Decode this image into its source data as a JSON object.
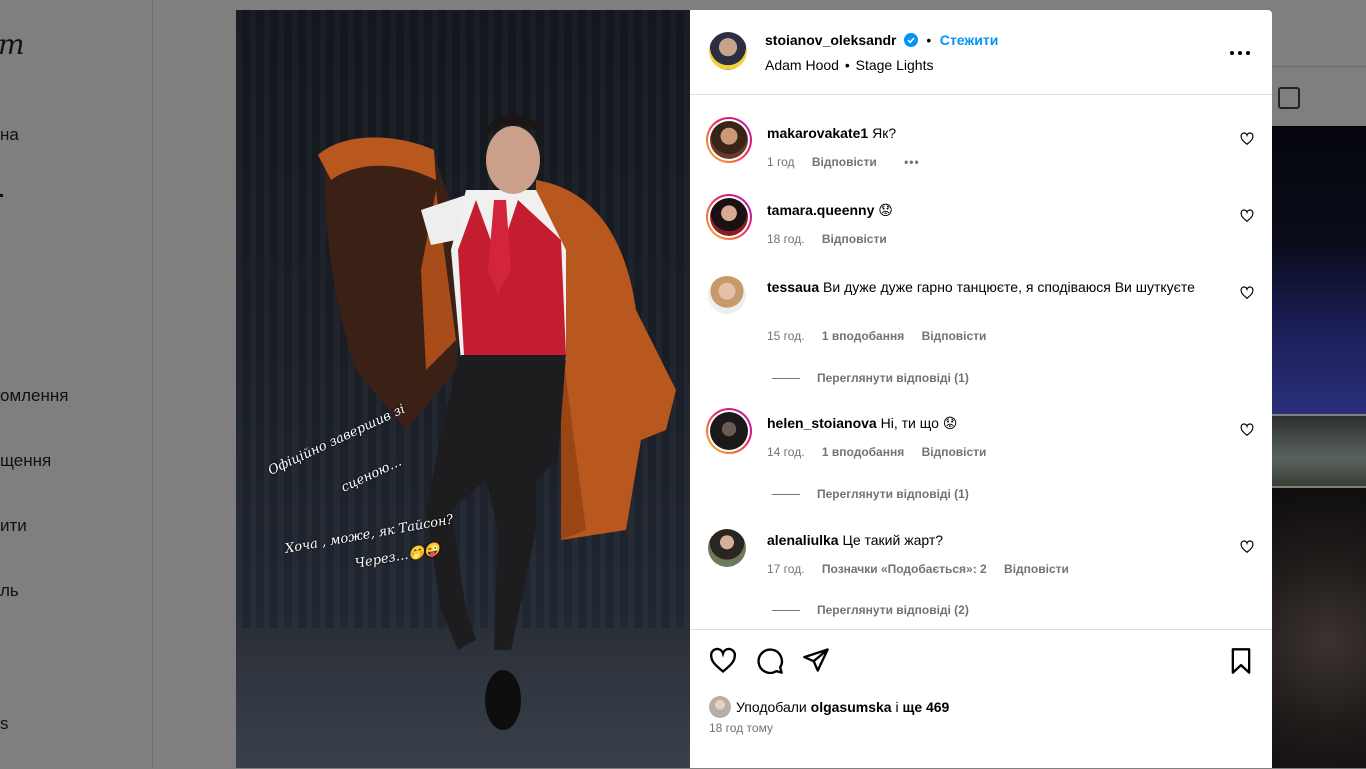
{
  "background": {
    "logo": "m",
    "nav": [
      "на",
      "омлення",
      "щення",
      "ити",
      "ль",
      "s"
    ]
  },
  "post": {
    "author": "stoianov_oleksandr",
    "verified_icon": "verified-badge-icon",
    "follow_label": "Стежити",
    "separator": "•",
    "audio": "Adam Hood",
    "audio_track": "Stage Lights",
    "more_icon": "more-horizontal-icon"
  },
  "caption": {
    "line1": "Офіційно завершив зі",
    "line2": "сценою…",
    "line3": "Хоча , може, як Тайсон?",
    "line4": "Через…🤭😜"
  },
  "comments": [
    {
      "user": "makarovakate1",
      "text": "Як?",
      "time": "1 год",
      "likes": "",
      "reply": "Відповісти",
      "more": "•••",
      "view_replies": ""
    },
    {
      "user": "tamara.queenny",
      "text": "😟",
      "time": "18 год.",
      "likes": "",
      "reply": "Відповісти",
      "more": "",
      "view_replies": ""
    },
    {
      "user": "tessaua",
      "text": "Ви дуже дуже гарно танцюєте, я сподіваюся Ви шуткуєте",
      "time": "15 год.",
      "likes": "1 вподобання",
      "reply": "Відповісти",
      "more": "",
      "view_replies": "Переглянути відповіді (1)"
    },
    {
      "user": "helen_stoianova",
      "text": "Ні, ти що 😟",
      "time": "14 год.",
      "likes": "1 вподобання",
      "reply": "Відповісти",
      "more": "",
      "view_replies": "Переглянути відповіді (1)"
    },
    {
      "user": "alenaliulka",
      "text": "Це такий жарт?",
      "time": "17 год.",
      "likes": "Позначки «Подобається»: 2",
      "reply": "Відповісти",
      "more": "",
      "view_replies": "Переглянути відповіді (2)"
    }
  ],
  "footer": {
    "liked_prefix": "Уподобали",
    "liked_user": "olgasumska",
    "liked_joiner": "і",
    "liked_rest": "ще 469",
    "time": "18 год тому"
  },
  "icons": {
    "like": "heart-icon",
    "comment": "comment-bubble-icon",
    "share": "send-paper-plane-icon",
    "save": "bookmark-icon"
  },
  "colors": {
    "accent": "#0095f6",
    "verified": "#0095f6",
    "muted": "#737373",
    "coat": "#b8581f",
    "vest": "#c41d2f"
  }
}
